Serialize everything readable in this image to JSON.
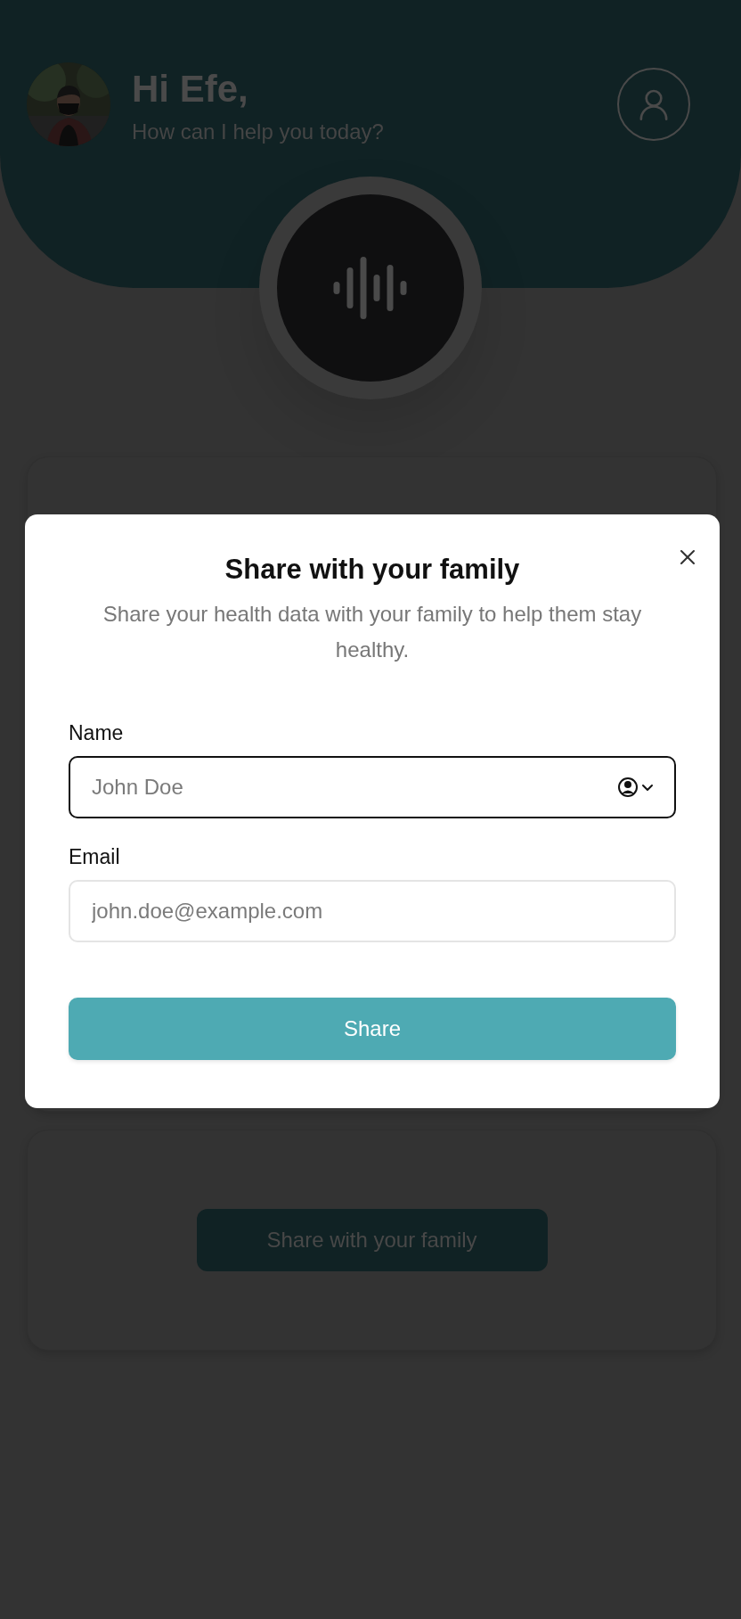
{
  "header": {
    "greeting": "Hi Efe,",
    "subtitle": "How can I help you today?"
  },
  "share_card": {
    "button": "Share with your family"
  },
  "dialog": {
    "title": "Share with your family",
    "description": "Share your health data with your family to help them stay healthy.",
    "fields": [
      {
        "label": "Name",
        "placeholder": "John Doe",
        "focused": true,
        "autofill": true
      },
      {
        "label": "Email",
        "placeholder": "john.doe@example.com",
        "focused": false,
        "autofill": false
      }
    ],
    "submit": "Share"
  }
}
